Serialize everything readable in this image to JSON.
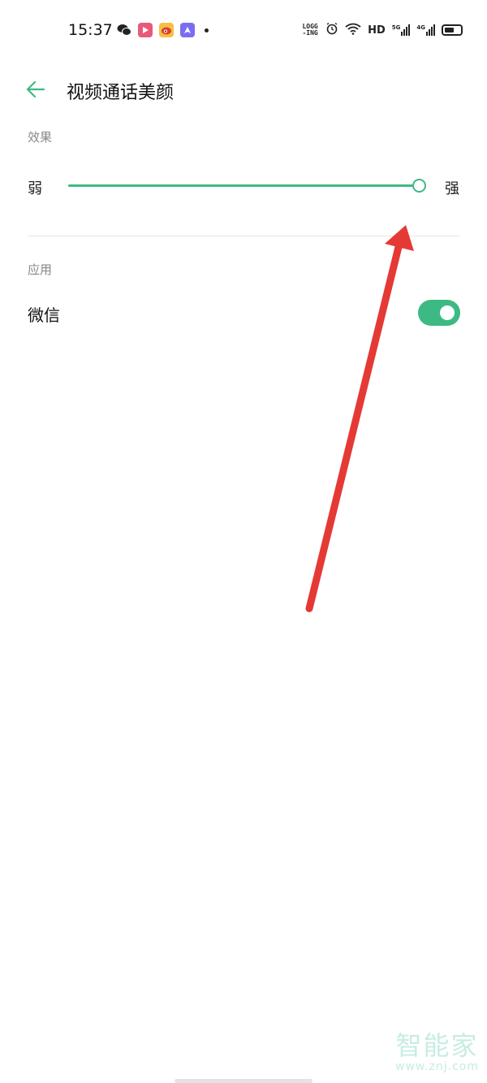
{
  "status_bar": {
    "time": "15:37",
    "notification_icons": [
      {
        "name": "wechat-icon",
        "color": "#222222"
      },
      {
        "name": "video-app-icon",
        "color": "#e85a7a"
      },
      {
        "name": "weibo-icon",
        "color": "#f2a31c"
      },
      {
        "name": "app-icon",
        "color": "#7a6ef0"
      }
    ],
    "logging_label": "LOGG -ING",
    "hd_label": "HD",
    "network_5g": "5G",
    "network_4g": "4G",
    "battery_level": 0.6
  },
  "header": {
    "back_icon": "arrow-left-icon",
    "title": "视频通话美颜"
  },
  "effect": {
    "section_label": "效果",
    "min_label": "弱",
    "max_label": "强",
    "value": 1.0
  },
  "apps": {
    "section_label": "应用",
    "items": [
      {
        "label": "微信",
        "enabled": true
      }
    ]
  },
  "watermark": {
    "logo": "智能家",
    "url": "www.znj.com"
  },
  "colors": {
    "accent": "#3dba83",
    "annotation_arrow": "#e53935"
  }
}
